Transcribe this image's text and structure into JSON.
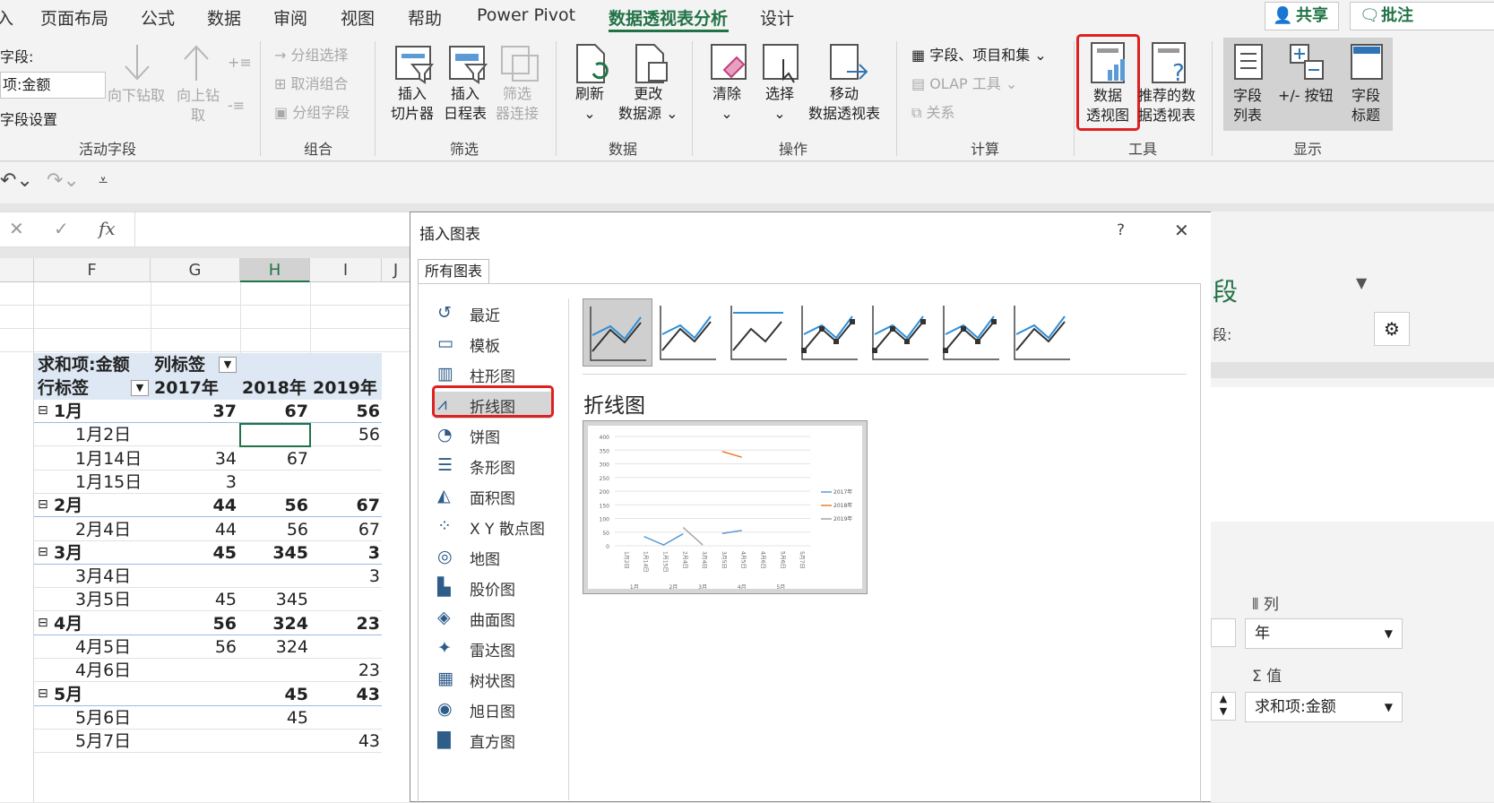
{
  "tabs": {
    "t0": "入",
    "t1": "页面布局",
    "t2": "公式",
    "t3": "数据",
    "t4": "审阅",
    "t5": "视图",
    "t6": "帮助",
    "t7": "Power Pivot",
    "t8": "数据透视表分析",
    "t9": "设计",
    "share": "共享",
    "comment": "批注"
  },
  "ribbon": {
    "active_field": {
      "label": "字段:",
      "value": "项:金额",
      "settings": "字段设置",
      "drill_down": "向下钻取",
      "drill_up": "向上钻取",
      "group": "活动字段"
    },
    "group_grp": {
      "sel": "分组选择",
      "ungroup": "取消组合",
      "field": "分组字段",
      "group": "组合"
    },
    "filter": {
      "slicer1": "插入",
      "slicer2": "切片器",
      "tl1": "插入",
      "tl2": "日程表",
      "fc1": "筛选",
      "fc2": "器连接",
      "group": "筛选"
    },
    "data": {
      "refresh": "刷新",
      "change1": "更改",
      "change2": "数据源",
      "group": "数据"
    },
    "actions": {
      "clear": "清除",
      "select": "选择",
      "move1": "移动",
      "move2": "数据透视表",
      "group": "操作"
    },
    "calc": {
      "fields": "字段、项目和集",
      "olap": "OLAP 工具",
      "rel": "关系",
      "group": "计算"
    },
    "tools": {
      "pc1": "数据",
      "pc2": "透视图",
      "rec1": "推荐的数",
      "rec2": "据透视表",
      "group": "工具"
    },
    "show": {
      "fl1": "字段",
      "fl2": "列表",
      "pm": "+/- 按钮",
      "fh1": "字段",
      "fh2": "标题",
      "group": "显示"
    }
  },
  "formula": {
    "fx": "fx"
  },
  "sheet": {
    "cols": [
      "F",
      "G",
      "H",
      "I",
      "J"
    ],
    "pivot_header": {
      "sum": "求和项:金额",
      "col_label": "列标签",
      "row_label": "行标签",
      "y2017": "2017年",
      "y2018": "2018年",
      "y2019": "2019年"
    },
    "rows": [
      {
        "label": "1月",
        "g": "37",
        "h": "67",
        "i": "56",
        "bold": true
      },
      {
        "label": "1月2日",
        "g": "",
        "h": "",
        "i": "56",
        "bold": false
      },
      {
        "label": "1月14日",
        "g": "34",
        "h": "67",
        "i": "",
        "bold": false
      },
      {
        "label": "1月15日",
        "g": "3",
        "h": "",
        "i": "",
        "bold": false
      },
      {
        "label": "2月",
        "g": "44",
        "h": "56",
        "i": "67",
        "bold": true
      },
      {
        "label": "2月4日",
        "g": "44",
        "h": "56",
        "i": "67",
        "bold": false
      },
      {
        "label": "3月",
        "g": "45",
        "h": "345",
        "i": "3",
        "bold": true
      },
      {
        "label": "3月4日",
        "g": "",
        "h": "",
        "i": "3",
        "bold": false
      },
      {
        "label": "3月5日",
        "g": "45",
        "h": "345",
        "i": "",
        "bold": false
      },
      {
        "label": "4月",
        "g": "56",
        "h": "324",
        "i": "23",
        "bold": true
      },
      {
        "label": "4月5日",
        "g": "56",
        "h": "324",
        "i": "",
        "bold": false
      },
      {
        "label": "4月6日",
        "g": "",
        "h": "",
        "i": "23",
        "bold": false
      },
      {
        "label": "5月",
        "g": "",
        "h": "45",
        "i": "43",
        "bold": true
      },
      {
        "label": "5月6日",
        "g": "",
        "h": "45",
        "i": "",
        "bold": false
      },
      {
        "label": "5月7日",
        "g": "",
        "h": "",
        "i": "43",
        "bold": false
      }
    ]
  },
  "dialog": {
    "title": "插入图表",
    "help": "?",
    "close": "✕",
    "tab": "所有图表",
    "categories": [
      {
        "label": "最近"
      },
      {
        "label": "模板"
      },
      {
        "label": "柱形图"
      },
      {
        "label": "折线图"
      },
      {
        "label": "饼图"
      },
      {
        "label": "条形图"
      },
      {
        "label": "面积图"
      },
      {
        "label": "X Y 散点图"
      },
      {
        "label": "地图"
      },
      {
        "label": "股价图"
      },
      {
        "label": "曲面图"
      },
      {
        "label": "雷达图"
      },
      {
        "label": "树状图"
      },
      {
        "label": "旭日图"
      },
      {
        "label": "直方图"
      }
    ],
    "selected_type": "折线图",
    "preview": {
      "type": "line",
      "y_ticks": [
        "400",
        "350",
        "300",
        "250",
        "200",
        "150",
        "100",
        "50",
        "0"
      ],
      "x_labels": [
        "1月2日",
        "1月14日",
        "1月15日",
        "2月4日",
        "3月4日",
        "3月5日",
        "4月5日",
        "4月6日",
        "5月6日",
        "5月7日"
      ],
      "months": [
        "1月",
        "2月",
        "3月",
        "4月",
        "5月"
      ],
      "series": [
        {
          "name": "2017年",
          "color": "#5b9bd5"
        },
        {
          "name": "2018年",
          "color": "#ed7d31"
        },
        {
          "name": "2019年",
          "color": "#a5a5a5"
        }
      ]
    }
  },
  "chart_data": {
    "type": "line",
    "x": [
      "1月2日",
      "1月14日",
      "1月15日",
      "2月4日",
      "3月4日",
      "3月5日",
      "4月5日",
      "4月6日",
      "5月6日",
      "5月7日"
    ],
    "series": [
      {
        "name": "2017年",
        "values": [
          null,
          34,
          3,
          44,
          null,
          45,
          56,
          null,
          null,
          null
        ]
      },
      {
        "name": "2018年",
        "values": [
          null,
          67,
          null,
          56,
          null,
          345,
          324,
          null,
          45,
          null
        ]
      },
      {
        "name": "2019年",
        "values": [
          56,
          null,
          null,
          67,
          3,
          null,
          null,
          23,
          null,
          43
        ]
      }
    ],
    "ylim": [
      0,
      400
    ]
  },
  "panel": {
    "title_part": "段",
    "search_part": "段:",
    "col_label": "列",
    "col_value": "年",
    "val_label": "值",
    "val_value": "求和项:金额"
  }
}
